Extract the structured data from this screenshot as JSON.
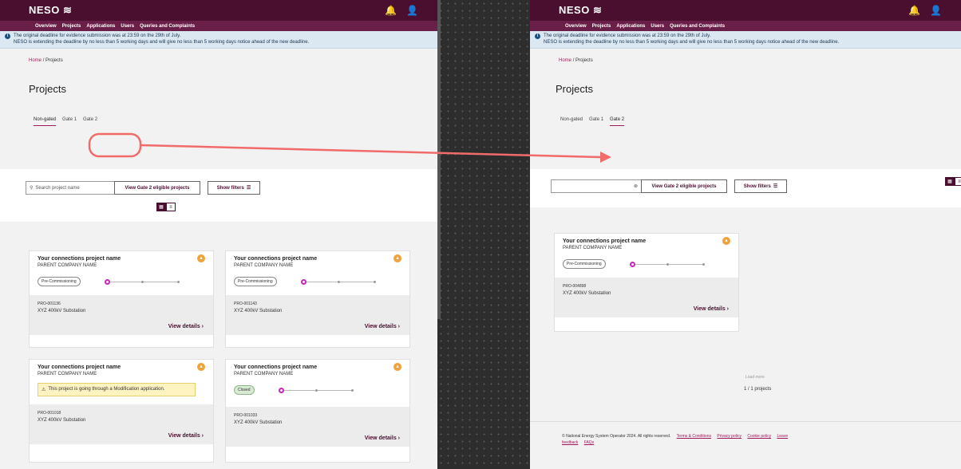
{
  "brand": "NESO",
  "nav": [
    "Overview",
    "Projects",
    "Applications",
    "Users",
    "Queries and Complaints"
  ],
  "banner": {
    "line1": "The original deadline for evidence submission was at 23:59 on the 29th of July.",
    "line2": "NESO is extending the deadline by no less than 5 working days and will give no less than 5 working days notice ahead of the new deadline."
  },
  "breadcrumb": {
    "home": "Home",
    "sep": "/",
    "current": "Projects"
  },
  "page_title": "Projects",
  "tabs": [
    "Non-gated",
    "Gate 1",
    "Gate 2"
  ],
  "search_placeholder": "Search project name",
  "btn_gate2": "View Gate 2 eligible projects",
  "btn_filters": "Show filters",
  "card_title": "Your connections project name",
  "card_company": "PARENT COMPANY NAME",
  "stage_precomm": "Pre-Commissioning",
  "stage_closed": "Closed",
  "substation": "XYZ 400kV Substation",
  "view_details": "View details",
  "warning_text": "This project is going through a Modification application.",
  "left_ids": [
    "PRO-001136",
    "PRO-001143",
    "PRO-001018",
    "PRO-001033"
  ],
  "right_id": "PRO-004898",
  "load_more": "Load more",
  "count": "1 / 1 projects",
  "footer": {
    "copyright": "© National Energy System Operator 2024. All rights reserved.",
    "links": [
      "Terms & Conditions",
      "Privacy policy",
      "Cookie policy",
      "Leave"
    ],
    "links2": [
      "feedback",
      "FAQs"
    ]
  },
  "colors": {
    "brand": "#4a0e2f",
    "accent": "#a0185c",
    "annotation": "#f26b6b"
  }
}
